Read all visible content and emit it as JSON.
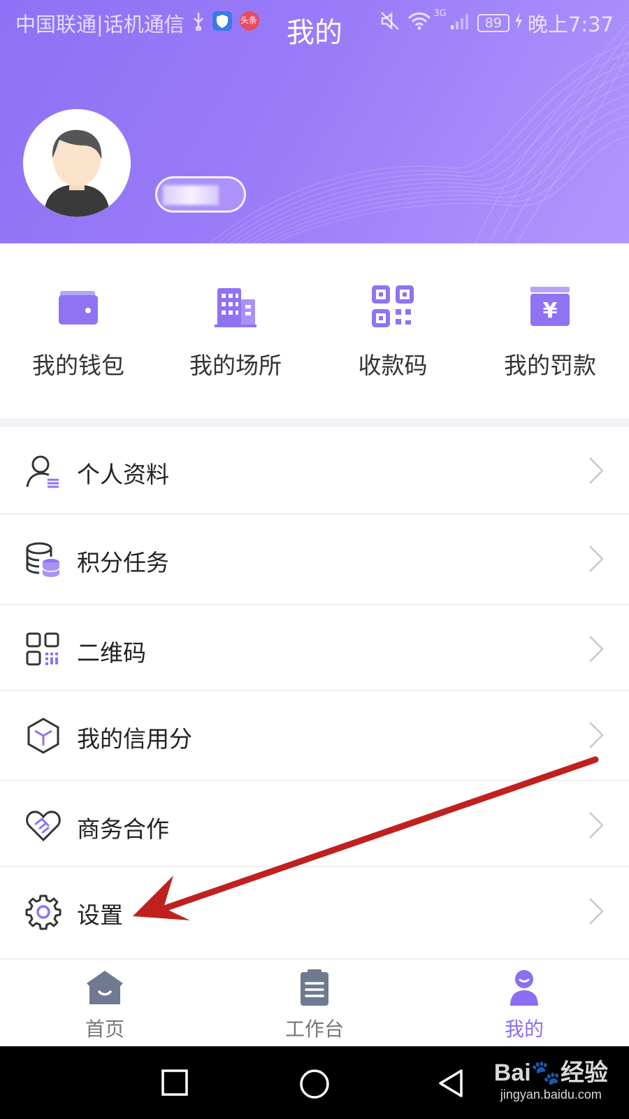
{
  "status_bar": {
    "carrier": "中国联通|话机通信",
    "app_badge": "头条",
    "battery": "89",
    "time": "晚上7:37",
    "network": "3G"
  },
  "header": {
    "title": "我的",
    "background_color": "#9579f7"
  },
  "quick_actions": [
    {
      "label": "我的钱包",
      "icon": "wallet-icon"
    },
    {
      "label": "我的场所",
      "icon": "building-icon"
    },
    {
      "label": "收款码",
      "icon": "qr-code-icon"
    },
    {
      "label": "我的罚款",
      "icon": "yuan-fine-icon"
    }
  ],
  "menu": [
    {
      "label": "个人资料",
      "icon": "user-profile-icon"
    },
    {
      "label": "积分任务",
      "icon": "coin-stack-icon"
    },
    {
      "label": "二维码",
      "icon": "qr-grid-icon"
    },
    {
      "label": "我的信用分",
      "icon": "cube-icon"
    },
    {
      "label": "商务合作",
      "icon": "handshake-heart-icon"
    },
    {
      "label": "设置",
      "icon": "gear-icon"
    }
  ],
  "tabbar": {
    "items": [
      {
        "label": "首页",
        "icon": "home-icon"
      },
      {
        "label": "工作台",
        "icon": "clipboard-icon"
      },
      {
        "label": "我的",
        "icon": "person-icon",
        "active": true
      }
    ],
    "active_color": "#8b6ef2"
  },
  "watermark": {
    "main": "Bai🐾经验",
    "sub": "jingyan.baidu.com"
  },
  "colors": {
    "accent": "#8b6ef2",
    "annotation_arrow": "#c0201e"
  }
}
